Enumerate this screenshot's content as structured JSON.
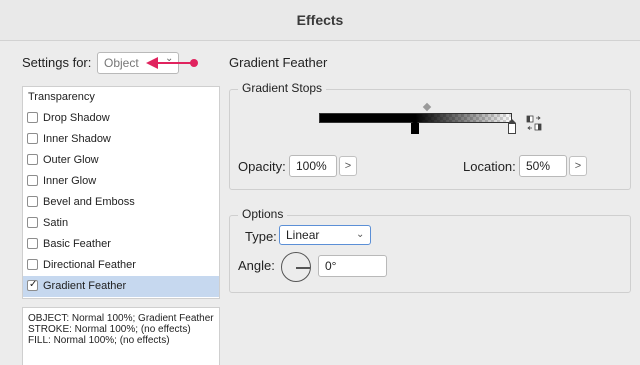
{
  "window": {
    "title": "Effects"
  },
  "settings": {
    "label": "Settings for:",
    "selected": "Object"
  },
  "effects_list": {
    "header": "Transparency",
    "items": [
      {
        "label": "Drop Shadow",
        "checked": false
      },
      {
        "label": "Inner Shadow",
        "checked": false
      },
      {
        "label": "Outer Glow",
        "checked": false
      },
      {
        "label": "Inner Glow",
        "checked": false
      },
      {
        "label": "Bevel and Emboss",
        "checked": false
      },
      {
        "label": "Satin",
        "checked": false
      },
      {
        "label": "Basic Feather",
        "checked": false
      },
      {
        "label": "Directional Feather",
        "checked": false
      },
      {
        "label": "Gradient Feather",
        "checked": true,
        "selected": true
      }
    ]
  },
  "summary": {
    "line1": "OBJECT: Normal 100%; Gradient Feather",
    "line2": "STROKE: Normal 100%; (no effects)",
    "line3": "FILL: Normal 100%; (no effects)"
  },
  "panel": {
    "title": "Gradient Feather",
    "gradient_stops": {
      "title": "Gradient Stops",
      "opacity_label": "Opacity:",
      "opacity_value": "100%",
      "location_label": "Location:",
      "location_value": "50%",
      "stepper_glyph": ">"
    },
    "options": {
      "title": "Options",
      "type_label": "Type:",
      "type_value": "Linear",
      "angle_label": "Angle:",
      "angle_value": "0°"
    }
  },
  "annotation": {
    "color": "#e0235e",
    "icon": "red-pointer-arrow"
  },
  "colors": {
    "selection": "#c6d8ef",
    "focus_border": "#5b8fd6"
  }
}
